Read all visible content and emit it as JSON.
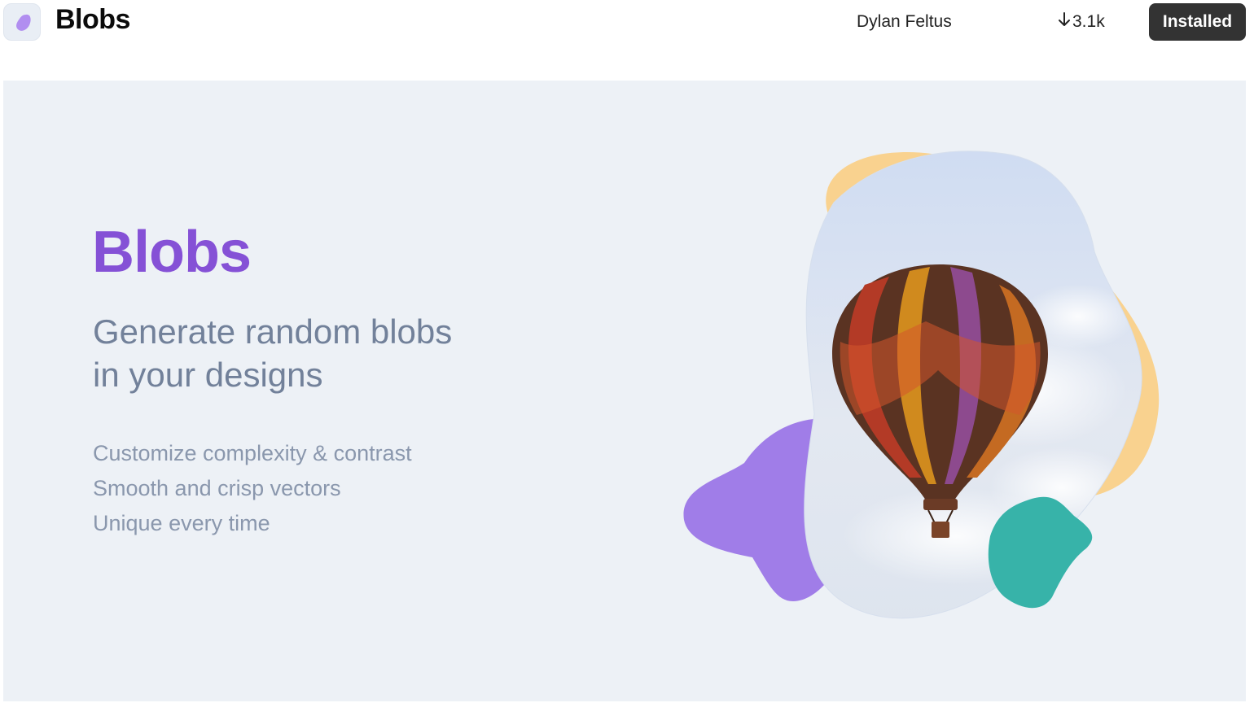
{
  "header": {
    "app_title": "Blobs",
    "author": "Dylan Feltus",
    "downloads": "3.1k",
    "install_label": "Installed"
  },
  "hero": {
    "title": "Blobs",
    "subtitle_line1": "Generate random blobs",
    "subtitle_line2": "in your designs",
    "features": [
      "Customize complexity & contrast",
      "Smooth and crisp vectors",
      "Unique every time"
    ]
  },
  "colors": {
    "accent_purple": "#8551d6",
    "blob_purple": "#a07de8",
    "blob_orange": "#f9d28f",
    "blob_teal": "#37b3a9",
    "button_dark": "#333333",
    "hero_bg": "#edf1f6"
  },
  "icons": {
    "app_icon": "blob-icon",
    "downloads_icon": "arrow-down-icon"
  }
}
